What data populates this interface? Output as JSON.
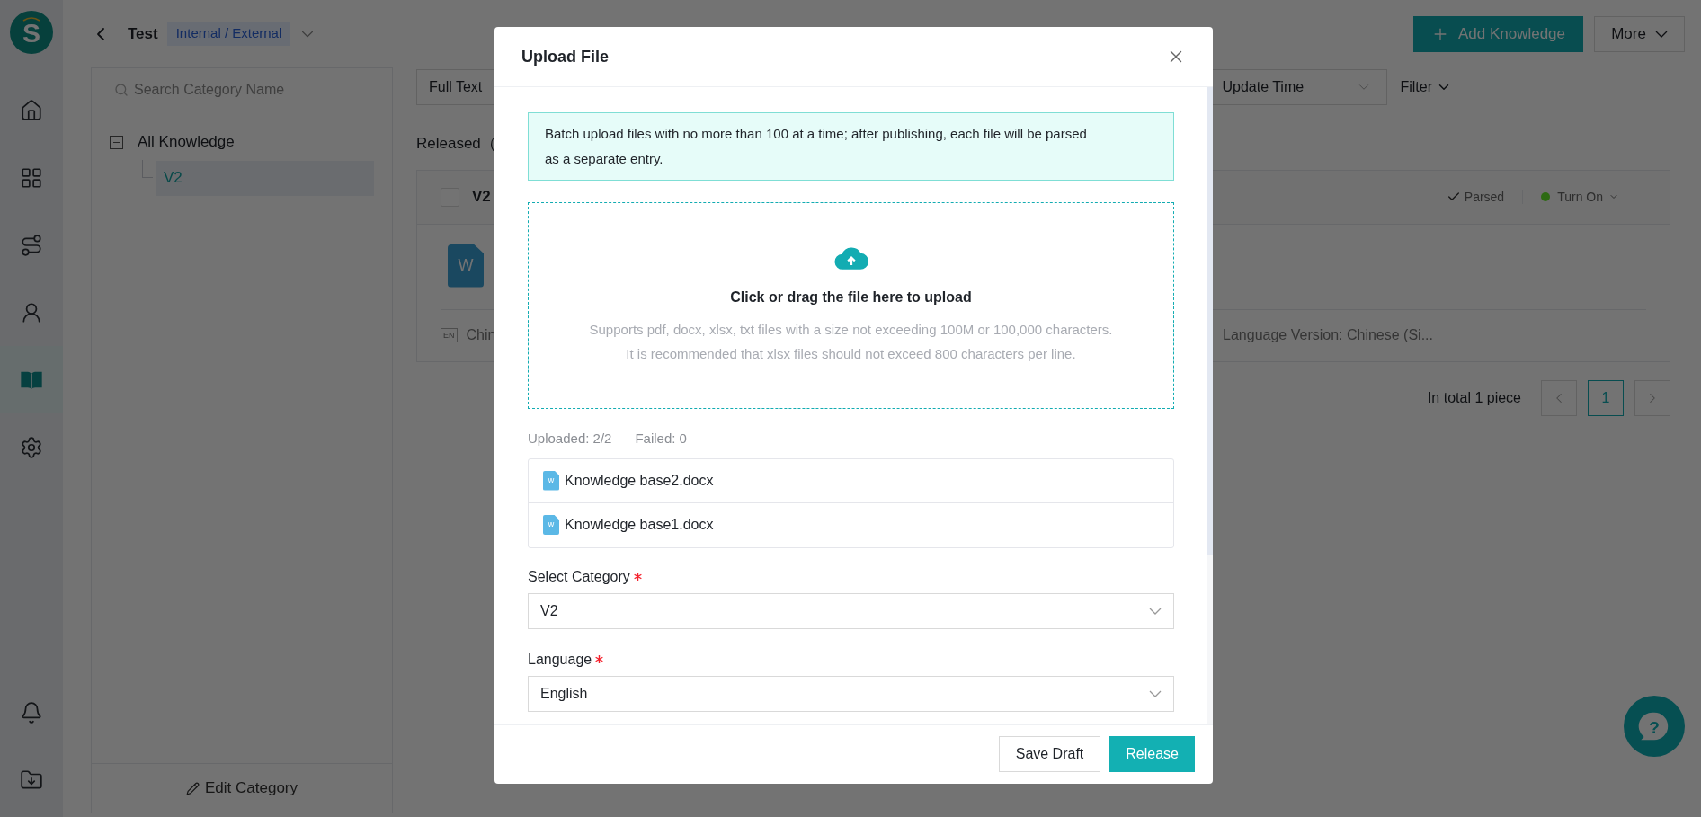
{
  "sidebar": {
    "logo_text": "S",
    "items": [
      {
        "selected": false
      },
      {
        "selected": false
      },
      {
        "selected": false
      },
      {
        "selected": false
      },
      {
        "selected": true
      },
      {
        "selected": false
      }
    ],
    "bottom_items": [
      {
        "selected": false
      },
      {
        "selected": false
      }
    ]
  },
  "help_symbol": "?",
  "header": {
    "title": "Test",
    "tag": "Internal / External",
    "add_button": "Add Knowledge",
    "more_button": "More"
  },
  "category_panel": {
    "search_placeholder": "Search Category Name",
    "tree": [
      {
        "label": "All Knowledge",
        "expanded": true,
        "selected": false,
        "children": [
          {
            "label": "V2",
            "selected": true
          }
        ]
      }
    ],
    "edit_button": "Edit Category"
  },
  "toolbar": {
    "search_mode": "Full Text",
    "sort": "Update Time",
    "filter": "Filter"
  },
  "list": {
    "heading": "Released（",
    "cards": [
      {
        "title": "V2",
        "checked": false,
        "icon_letter": "W",
        "status": "Parsed",
        "toggle": "Turn On",
        "color": "#2d6a13",
        "language_tag": "EN",
        "language_left": "Chin",
        "language_right": "Language Version: Chinese (Si..."
      }
    ]
  },
  "pagination": {
    "total": "In total 1 piece",
    "pages": [
      {
        "label": "1",
        "selected": true
      }
    ]
  },
  "modal": {
    "title": "Upload File",
    "notice": "Batch upload files with no more than 100 at a time; after publishing, each file will be parsed as a separate entry.",
    "dropzone": {
      "title": "Click or drag the file here to upload",
      "hints": [
        "Supports pdf, docx, xlsx, txt files with a size not exceeding 100M or 100,000 characters.",
        "It is recommended that xlsx files should not exceed 800 characters per line."
      ]
    },
    "uploaded": "Uploaded: 2/2",
    "failed": "Failed: 0",
    "files": [
      {
        "name": "Knowledge base2.docx",
        "icon_letter": "w"
      },
      {
        "name": "Knowledge base1.docx",
        "icon_letter": "w"
      }
    ],
    "fields": [
      {
        "label": "Select Category",
        "required": true,
        "value": "V2"
      },
      {
        "label": "Language",
        "required": true,
        "value": "English"
      }
    ],
    "buttons": [
      {
        "label": "Save Draft",
        "kind": "secondary"
      },
      {
        "label": "Release",
        "kind": "primary"
      }
    ]
  }
}
